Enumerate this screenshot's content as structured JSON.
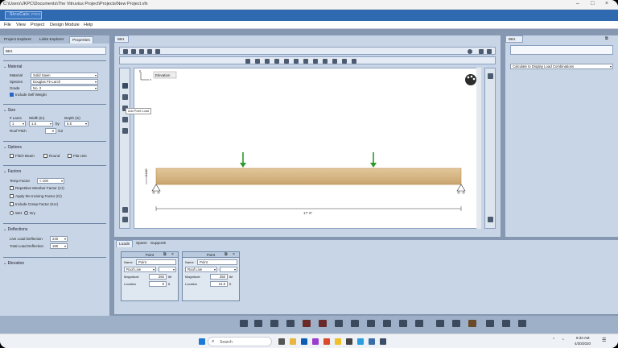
{
  "window": {
    "title": "C:\\Users\\JKPC\\Documents\\The Vitruvius Project\\Projects\\New Project.vfx",
    "min": "–",
    "max": "□",
    "close": "×"
  },
  "app": {
    "logo": "StruCalc",
    "logo_suffix": "PRO"
  },
  "menu": [
    "File",
    "View",
    "Project",
    "Design Module",
    "Help"
  ],
  "left": {
    "tabs": [
      "Project Explorer",
      "Links Explorer",
      "Properties"
    ],
    "id_box": "BB1",
    "material": {
      "title": "Material",
      "material_label": "Material",
      "material_value": "Solid Sawn",
      "species_label": "Species",
      "species_value": "Douglas Fir-Larch",
      "grade_label": "Grade",
      "grade_value": "No. 2",
      "self_weight": "Include Self Weight"
    },
    "size": {
      "title": "Size",
      "plies_label": "# Lams",
      "plies_value": "1",
      "width_label": "Width (in)",
      "width_value": "1.5",
      "depth_label": "Depth (in)",
      "depth_value": "5.5",
      "by": "by",
      "pitch_label": "Roof Pitch",
      "pitch_value": "0",
      "pitch_unit": "/12"
    },
    "options": {
      "title": "Options",
      "flitch": "Flitch Beam",
      "round": "Round",
      "flat": "Flat Use"
    },
    "factors": {
      "title": "Factors",
      "temp_label": "Temp Factor",
      "temp_value": "< 100",
      "repetitive": "Repetitive Member Factor (Cr)",
      "incising": "Apply the Incising Factor (Ci)",
      "creep": "Include Creep Factor (Kcr)",
      "wet": "Wet",
      "dry": "Dry"
    },
    "deflections": {
      "title": "Deflections",
      "live_label": "Live Load Deflection",
      "live_value": "240",
      "total_label": "Total Load Deflection",
      "total_value": "180"
    },
    "elevation": {
      "title": "Elevation"
    }
  },
  "center": {
    "tab": "BB1",
    "tooltip": "Add Point Load",
    "canvas": {
      "label": "Elevation",
      "axis_y": "y",
      "axis_x": "x",
      "depth_dim": "5 1/2\"",
      "span_dim": "17' 6\""
    }
  },
  "right": {
    "tab": "BB1",
    "calc_label": "Calculate to Display Load Combinations"
  },
  "bottom": {
    "tabs": [
      "Loads",
      "Spans",
      "Supports"
    ],
    "cards": [
      {
        "title": "Point",
        "name_label": "Name",
        "name_value": "Point",
        "type_value": "Roof Live",
        "mag_label": "Magnitude",
        "mag_value": "250",
        "mag_unit": "lbf",
        "loc_label": "Location",
        "loc_value": "5",
        "loc_unit": "ft"
      },
      {
        "title": "Point",
        "name_label": "Name",
        "name_value": "Point",
        "type_value": "Roof Live",
        "mag_label": "Magnitude",
        "mag_value": "250",
        "mag_unit": "lbf",
        "loc_label": "Location",
        "loc_value": "12.5",
        "loc_unit": "ft"
      }
    ]
  },
  "taskbar": {
    "search": "Search",
    "time": "8:33 AM",
    "date": "4/30/2020"
  }
}
